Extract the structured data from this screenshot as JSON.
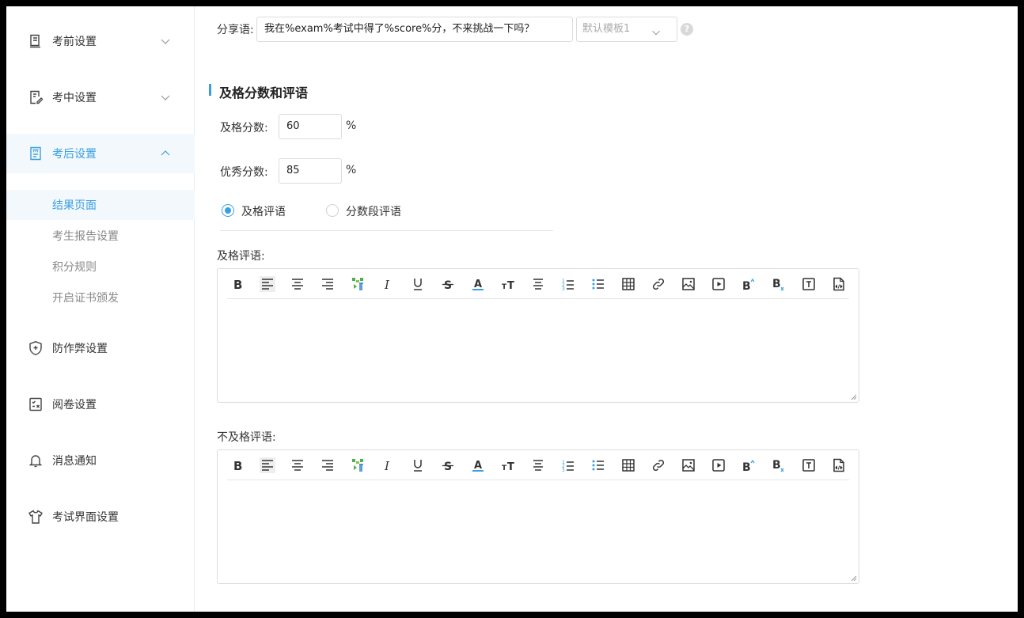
{
  "sidebar": {
    "items": [
      {
        "label": "考前设置",
        "icon": "document-icon",
        "expanded": false
      },
      {
        "label": "考中设置",
        "icon": "edit-document-icon",
        "expanded": false
      },
      {
        "label": "考后设置",
        "icon": "report-icon",
        "expanded": true
      },
      {
        "label": "防作弊设置",
        "icon": "shield-plus-icon"
      },
      {
        "label": "阅卷设置",
        "icon": "grading-icon"
      },
      {
        "label": "消息通知",
        "icon": "bell-icon"
      },
      {
        "label": "考试界面设置",
        "icon": "shirt-icon"
      }
    ],
    "sub_items": [
      {
        "label": "结果页面",
        "active": true
      },
      {
        "label": "考生报告设置"
      },
      {
        "label": "积分规则"
      },
      {
        "label": "开启证书颁发"
      }
    ]
  },
  "share": {
    "label": "分享语:",
    "value": "我在%exam%考试中得了%score%分，不来挑战一下吗？",
    "template_placeholder": "默认模板1",
    "help_icon": "?"
  },
  "section": {
    "title": "及格分数和评语",
    "pass_score_label": "及格分数:",
    "pass_score_value": "60",
    "excellent_score_label": "优秀分数:",
    "excellent_score_value": "85",
    "percent_unit": "%",
    "radio_pass_comment": "及格评语",
    "radio_segment_comment": "分数段评语",
    "pass_comment_label": "及格评语:",
    "fail_comment_label": "不及格评语:"
  },
  "colors": {
    "accent": "#3a9fe0",
    "active_bg": "#f3f8fd"
  },
  "toolbar_icons": [
    "bold-icon",
    "align-left-icon",
    "align-center-icon",
    "align-right-icon",
    "format-painter-icon",
    "italic-icon",
    "underline-icon",
    "strikethrough-icon",
    "font-color-icon",
    "font-size-icon",
    "line-height-icon",
    "ordered-list-icon",
    "unordered-list-icon",
    "table-icon",
    "link-icon",
    "image-icon",
    "video-icon",
    "superscript-icon",
    "subscript-icon",
    "text-box-icon",
    "html-source-icon"
  ]
}
